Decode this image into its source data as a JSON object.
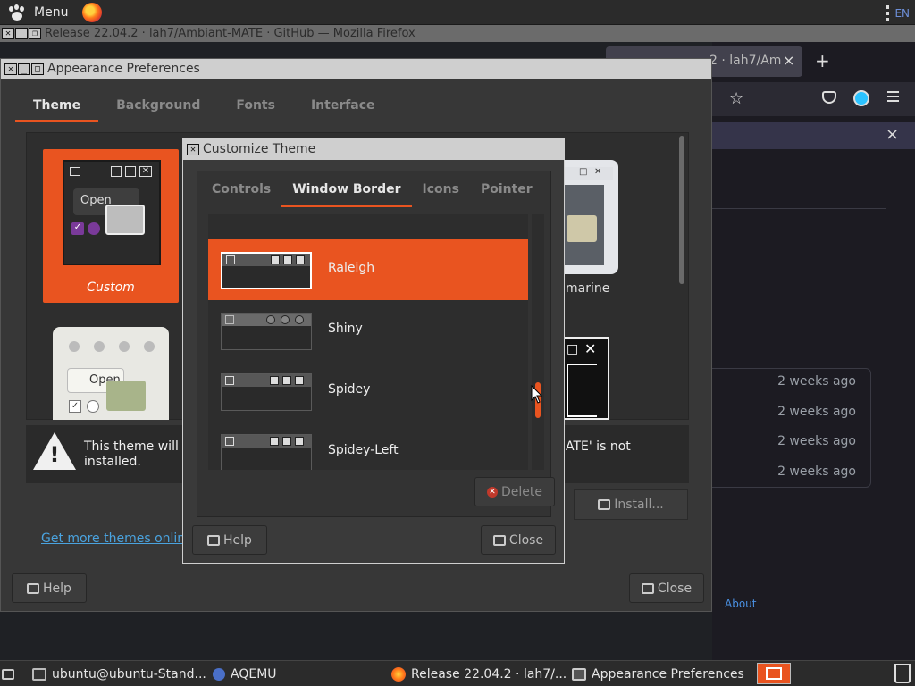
{
  "top_panel": {
    "menu_label": "Menu",
    "keyboard_layout": "EN"
  },
  "firefox": {
    "title": "Release 22.04.2 · lah7/Ambiant-MATE · GitHub — Mozilla Firefox",
    "tab_title": "2 · lah7/Am",
    "tab_close": "×",
    "new_tab": "+",
    "rows": [
      "2 weeks ago",
      "2 weeks ago",
      "2 weeks ago",
      "2 weeks ago"
    ],
    "about": "About",
    "notif_close": "×",
    "star": "☆"
  },
  "appearance": {
    "title": "Appearance Preferences",
    "tabs": [
      "Theme",
      "Background",
      "Fonts",
      "Interface"
    ],
    "active_tab": "Theme",
    "custom_label": "Custom",
    "aquamarine_label": "marine",
    "open_label": "Open",
    "warning_part1": "This theme will n installed.",
    "warning_part2": "ATE' is not",
    "install_label": "Install...",
    "more_themes_link": "Get more themes online",
    "help_label": "Help",
    "close_label": "Close"
  },
  "customize": {
    "title": "Customize Theme",
    "tabs": [
      "Controls",
      "Window Border",
      "Icons",
      "Pointer"
    ],
    "active_tab": "Window Border",
    "items": [
      {
        "name": "Raleigh",
        "selected": true
      },
      {
        "name": "Shiny",
        "selected": false
      },
      {
        "name": "Spidey",
        "selected": false
      },
      {
        "name": "Spidey-Left",
        "selected": false
      }
    ],
    "delete_label": "Delete",
    "help_label": "Help",
    "close_label": "Close"
  },
  "taskbar": {
    "items": [
      "ubuntu@ubuntu-Stand...",
      "AQEMU",
      "Release 22.04.2 · lah7/...",
      "Appearance Preferences"
    ]
  },
  "colors": {
    "accent": "#e95420",
    "link": "#4aa3df"
  }
}
